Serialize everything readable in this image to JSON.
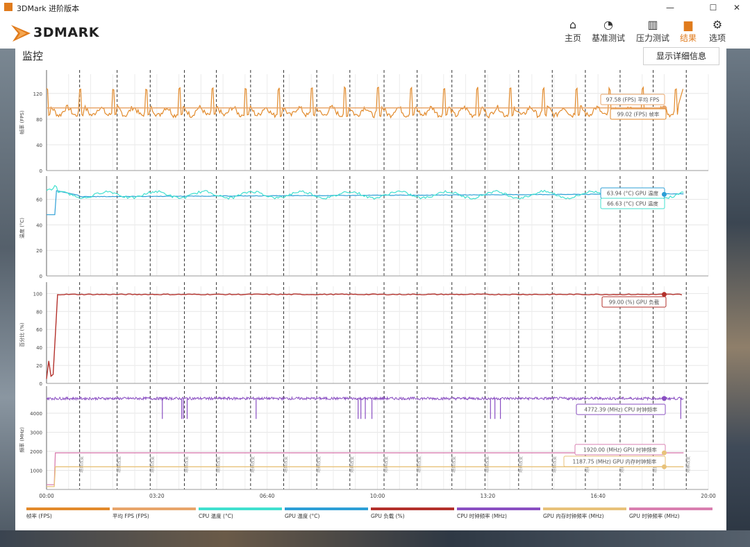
{
  "window": {
    "title": "3DMark 进阶版本",
    "minimize": "—",
    "maximize": "☐",
    "close": "✕"
  },
  "logo": {
    "text": "3DMARK"
  },
  "nav": [
    {
      "label": "主页",
      "icon": "home-icon",
      "glyph": "⌂"
    },
    {
      "label": "基准测试",
      "icon": "gauge-icon",
      "glyph": "◔"
    },
    {
      "label": "压力测试",
      "icon": "bar-chart-icon",
      "glyph": "▥"
    },
    {
      "label": "结果",
      "icon": "results-icon",
      "glyph": "▆",
      "active": true
    },
    {
      "label": "选项",
      "icon": "gear-icon",
      "glyph": "⚙"
    }
  ],
  "page": {
    "title": "监控",
    "details_button": "显示详细信息"
  },
  "colors": {
    "fps": "#e28a2b",
    "avg_fps": "#e8a56a",
    "cpu_temp": "#40e0cf",
    "gpu_temp": "#2d9fd6",
    "gpu_load": "#b3302b",
    "cpu_clock": "#8a4fc2",
    "gpu_mem_clock": "#e8c27a",
    "gpu_clock": "#d97fb0",
    "accent": "#e07b1c"
  },
  "chart_data": {
    "type": "line",
    "x_ticks": [
      "00:00",
      "03:20",
      "06:40",
      "10:00",
      "13:20",
      "16:40",
      "20:00"
    ],
    "marker_label": "场景改变",
    "panels": [
      {
        "ylabel": "帧率 (FPS)",
        "yticks": [
          "0",
          "40",
          "80",
          "120"
        ],
        "ylim": [
          0,
          150
        ],
        "series": [
          {
            "name": "帧率 (FPS)",
            "typical": 99.02,
            "range": [
              84,
              130
            ]
          },
          {
            "name": "平均 FPS (FPS)",
            "value": 97.58
          }
        ],
        "callouts": [
          "97.58 (FPS) 平均 FPS",
          "99.02 (FPS) 帧率"
        ]
      },
      {
        "ylabel": "温度 (°C)",
        "yticks": [
          "0",
          "20",
          "40",
          "60"
        ],
        "ylim": [
          0,
          75
        ],
        "series": [
          {
            "name": "CPU 温度 (°C)",
            "value": 66.63
          },
          {
            "name": "GPU 温度 (°C)",
            "value": 63.94,
            "start": 48
          }
        ],
        "callouts": [
          "63.94 (°C) GPU 温度",
          "66.63 (°C) CPU 温度"
        ]
      },
      {
        "ylabel": "百分比 (%)",
        "yticks": [
          "0",
          "20",
          "40",
          "60",
          "80",
          "100"
        ],
        "ylim": [
          0,
          108
        ],
        "series": [
          {
            "name": "GPU 负载 (%)",
            "value": 99.0
          }
        ],
        "callouts": [
          "99.00 (%) GPU 负载"
        ]
      },
      {
        "ylabel": "频率 (MHz)",
        "yticks": [
          "1000",
          "2000",
          "3000",
          "4000"
        ],
        "ylim": [
          0,
          5200
        ],
        "series": [
          {
            "name": "CPU 时钟频率 (MHz)",
            "value": 4772.39
          },
          {
            "name": "GPU 时钟频率 (MHz)",
            "value": 1920.0
          },
          {
            "name": "GPU 内存时钟频率 (MHz)",
            "value": 1187.75
          }
        ],
        "callouts": [
          "4772.39 (MHz) CPU 时钟频率",
          "1920.00 (MHz) GPU 时钟频率",
          "1187.75 (MHz) GPU 内存时钟频率"
        ]
      }
    ],
    "legend": [
      "帧率 (FPS)",
      "平均 FPS (FPS)",
      "CPU 温度 (°C)",
      "GPU 温度 (°C)",
      "GPU 负载 (%)",
      "CPU 时钟频率 (MHz)",
      "GPU 内存时钟频率 (MHz)",
      "GPU 时钟频率 (MHz)"
    ]
  }
}
